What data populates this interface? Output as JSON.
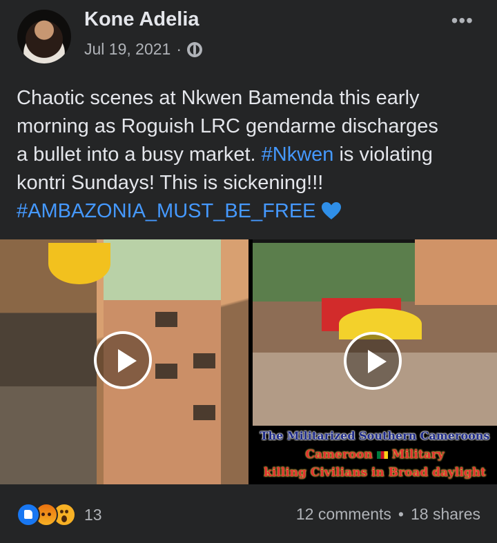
{
  "post": {
    "author": "Kone Adelia",
    "date": "Jul 19, 2021",
    "separator": "·",
    "audience_icon": "globe-icon",
    "more_label": "•••",
    "text_lines": {
      "line1": "Chaotic scenes at Nkwen Bamenda this early",
      "line2": "morning as Roguish LRC gendarme discharges",
      "line3_a": "a bullet into a busy market. ",
      "line3_tag": "#Nkwen",
      "line3_b": " is violating",
      "line4": "kontri Sundays! This is sickening!!!",
      "line5_tag": "#AMBAZONIA_MUST_BE_FREE"
    },
    "emoji": "blue-heart-icon",
    "tag_color": "#4599ff"
  },
  "media": {
    "videos": [
      {
        "play_icon": "play-icon"
      },
      {
        "play_icon": "play-icon",
        "caption_line1": "The Militarized Southern Cameroons",
        "caption_line2_a": "Cameroon ",
        "caption_line2_b": " Military",
        "caption_line3": "killing Civilians in Broad daylight"
      }
    ]
  },
  "footer": {
    "reaction_count": "13",
    "comments": "12 comments",
    "dot": "•",
    "shares": "18 shares"
  },
  "colors": {
    "background": "#242526",
    "text": "#e4e6eb",
    "muted": "#b0b3b8",
    "link": "#4599ff"
  }
}
